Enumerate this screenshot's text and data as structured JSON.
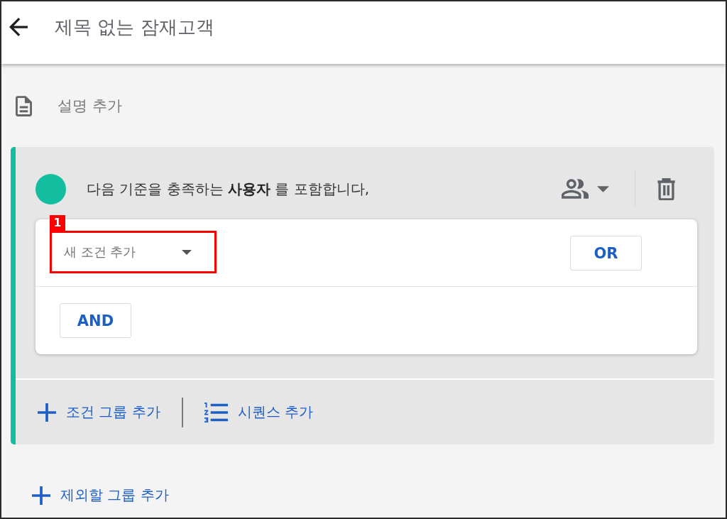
{
  "header": {
    "title": "제목 없는 잠재고객"
  },
  "description": {
    "label": "설명 추가"
  },
  "group": {
    "sentence": "다음 기준을 충족하는 **사용자** 를 포함합니다,",
    "condition": {
      "label": "새 조건 추가",
      "callout": "1"
    },
    "or_button": "OR",
    "and_button": "AND",
    "actions": [
      {
        "kind": "add-group",
        "label": "조건 그룹 추가"
      },
      {
        "kind": "sequence",
        "label": "시퀀스 추가"
      }
    ]
  },
  "exclude": {
    "label": "제외할 그룹 추가"
  }
}
